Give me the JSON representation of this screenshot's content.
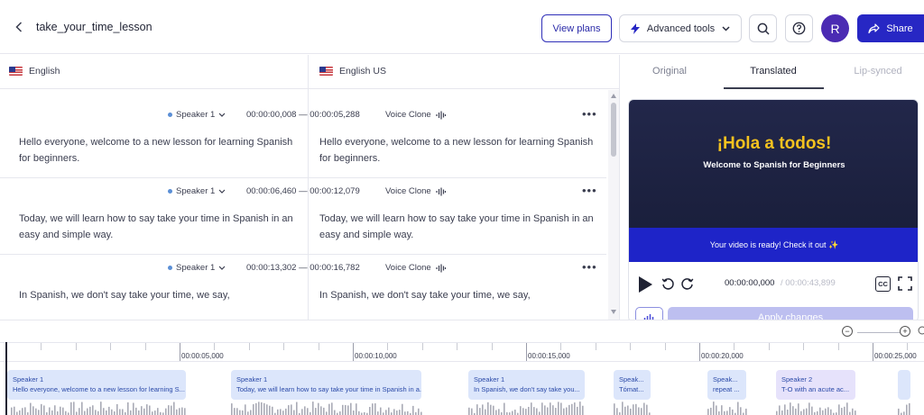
{
  "header": {
    "title": "take_your_time_lesson",
    "view_plans": "View plans",
    "advanced_tools": "Advanced tools",
    "avatar_initial": "R",
    "share": "Share"
  },
  "languages": {
    "source": "English",
    "target": "English US"
  },
  "segments": [
    {
      "speaker": "Speaker 1",
      "start": "00:00:00,008",
      "end": "00:00:05,288",
      "voice": "Voice Clone",
      "source_text": "Hello everyone, welcome to a new lesson for learning Spanish for beginners.",
      "target_text": "Hello everyone, welcome to a new lesson for learning Spanish for beginners."
    },
    {
      "speaker": "Speaker 1",
      "start": "00:00:06,460",
      "end": "00:00:12,079",
      "voice": "Voice Clone",
      "source_text": "Today, we will learn how to say take your time in Spanish in an easy and simple way.",
      "target_text": "Today, we will learn how to say take your time in Spanish in an easy and simple way."
    },
    {
      "speaker": "Speaker 1",
      "start": "00:00:13,302",
      "end": "00:00:16,782",
      "voice": "Voice Clone",
      "source_text": "In Spanish, we don't say take your time, we say,",
      "target_text": "In Spanish, we don't say take your time, we say,"
    }
  ],
  "time_separator": "—",
  "tabs": {
    "original": "Original",
    "translated": "Translated",
    "lip_synced": "Lip-synced",
    "active": "Translated"
  },
  "video": {
    "title": "¡Hola a todos!",
    "subtitle": "Welcome to Spanish for Beginners",
    "banner": "Your video is ready! Check it out ✨",
    "current_time": "00:00:00,000",
    "total_time": "/ 00:00:43,899",
    "cc": "CC",
    "apply_changes": "Apply changes"
  },
  "timeline": {
    "ruler_labels": [
      "00:00:05,000",
      "00:00:10,000",
      "00:00:15,000",
      "00:00:20,000",
      "00:00:25,000"
    ],
    "clips": [
      {
        "speaker": "Speaker 1",
        "text": "Hello everyone, welcome to a new lesson for learning S..."
      },
      {
        "speaker": "Speaker 1",
        "text": "Today, we will learn how to say take your time in Spanish in a..."
      },
      {
        "speaker": "Speaker 1",
        "text": "In Spanish, we don't say take you..."
      },
      {
        "speaker": "Speak...",
        "text": "Tómat..."
      },
      {
        "speaker": "Speak...",
        "text": "repeat ..."
      },
      {
        "speaker": "Speaker 2",
        "text": "T-O with an acute ac..."
      }
    ]
  },
  "colors": {
    "accent": "#2727c4",
    "video_bg": "#22274a",
    "video_title": "#f4c21f",
    "banner": "#1e24c8",
    "clip_bg": "#dce6fb"
  }
}
